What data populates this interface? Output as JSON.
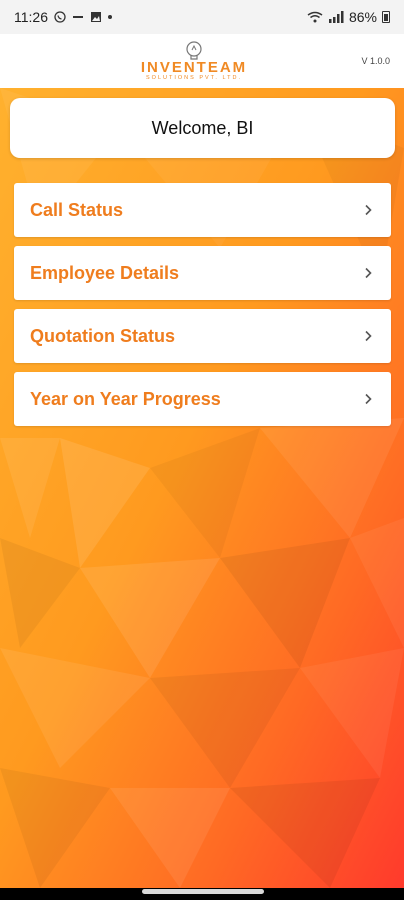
{
  "status_bar": {
    "time": "11:26",
    "battery_percent": "86%",
    "icons": [
      "whatsapp-icon",
      "minus-icon",
      "image-icon",
      "dot-icon",
      "wifi-icon",
      "signal-icon",
      "battery-icon"
    ]
  },
  "header": {
    "logo_text": "INVENTEAM",
    "logo_subtext": "SOLUTIONS PVT. LTD.",
    "version": "V 1.0.0"
  },
  "welcome": {
    "text": "Welcome, BI"
  },
  "menu": {
    "items": [
      {
        "label": "Call Status"
      },
      {
        "label": "Employee Details"
      },
      {
        "label": "Quotation Status"
      },
      {
        "label": "Year on Year Progress"
      }
    ]
  },
  "colors": {
    "accent": "#ef7d1e",
    "bg_top": "#ffa726",
    "bg_bottom": "#ff3d2e"
  }
}
